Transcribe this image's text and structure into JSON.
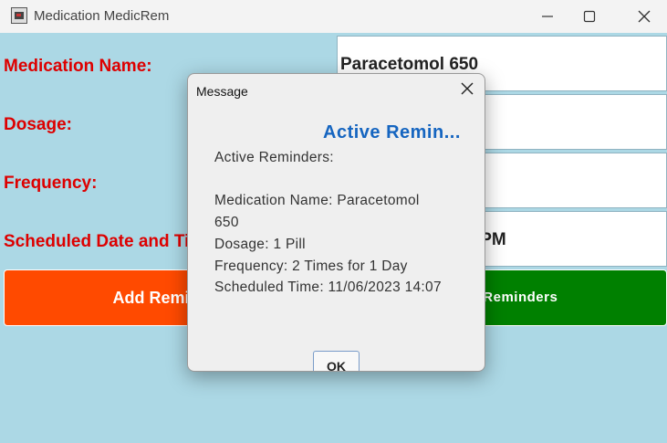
{
  "window": {
    "title": "Medication MedicRem"
  },
  "form": {
    "medication_label": "Medication Name:",
    "dosage_label": "Dosage:",
    "frequency_label": "Frequency:",
    "schedule_label": "Scheduled Date and Time:",
    "medication_value": "Paracetomol 650",
    "dosage_value": "",
    "frequency_value": "2 Times for 1 Day",
    "schedule_value": "11/06/2023 02:07 PM"
  },
  "buttons": {
    "add": "Add Reminder",
    "view": "View Reminders"
  },
  "dialog": {
    "title": "Message",
    "heading": "Active Remin...",
    "intro": "Active Reminders:",
    "name_line": "Medication Name: Paracetomol",
    "name_line_cont": "650",
    "dosage_line": "Dosage: 1 Pill",
    "frequency_line": "Frequency: 2 Times for 1 Day",
    "time_line": "Scheduled Time: 11/06/2023 14:07",
    "ok": "OK"
  },
  "colors": {
    "background": "#acd8e5",
    "label": "#dd0000",
    "add_button": "#ff4a00",
    "view_button": "#008000",
    "dialog_heading": "#1565c0"
  },
  "icons": [
    "app-icon",
    "minimize-icon",
    "maximize-icon",
    "close-icon"
  ]
}
